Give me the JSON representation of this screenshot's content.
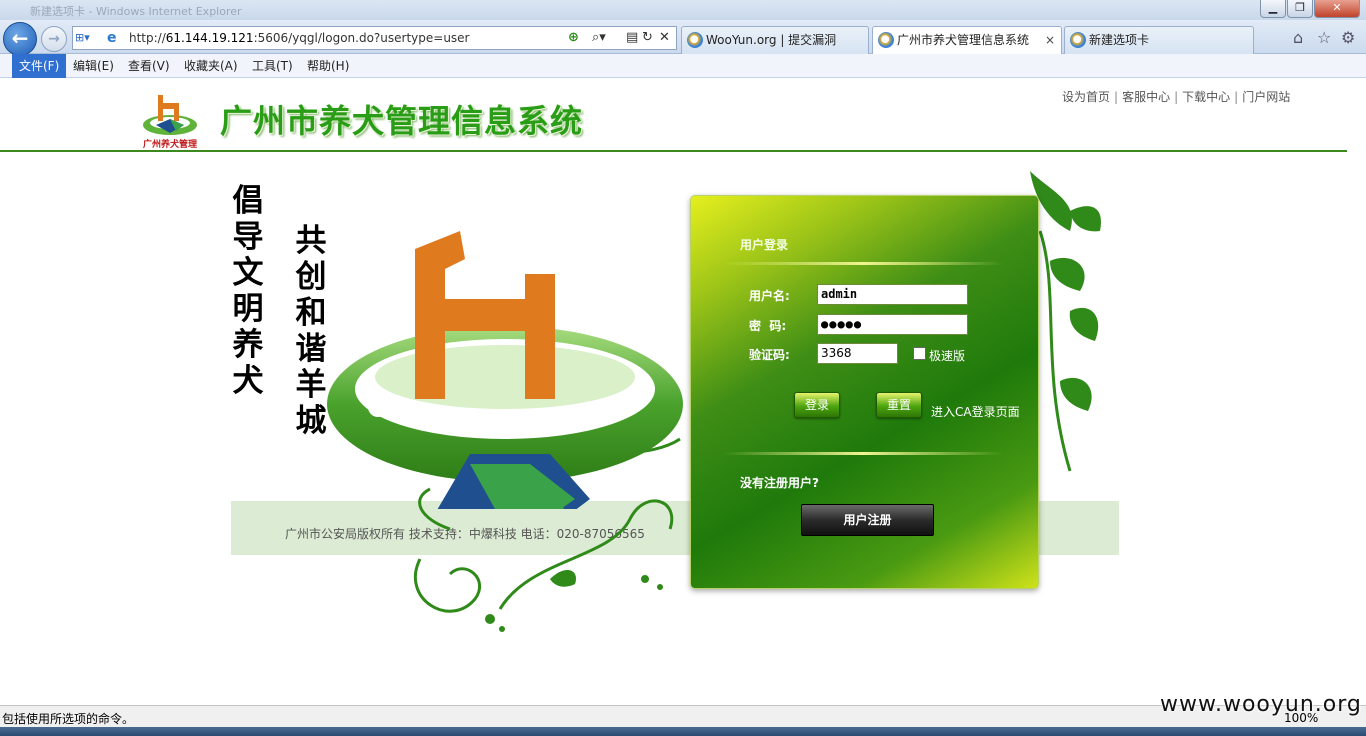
{
  "browser": {
    "window_title": "新建选项卡 - Windows Internet Explorer",
    "url_prefix": "http://",
    "url_host": "61.144.19.121",
    "url_rest": ":5606/yqgl/logon.do?usertype=user",
    "tabs": [
      {
        "label": "WooYun.org | 提交漏洞"
      },
      {
        "label": "广州市养犬管理信息系统",
        "close": "×"
      },
      {
        "label": "新建选项卡"
      }
    ],
    "menu": [
      "文件(F)",
      "编辑(E)",
      "查看(V)",
      "收藏夹(A)",
      "工具(T)",
      "帮助(H)"
    ],
    "status_text": "包括使用所选项的命令。",
    "zoom": "100%",
    "watermark": "www.wooyun.org"
  },
  "site": {
    "title": "广州市养犬管理信息系统",
    "logo_text": "广州养犬管理",
    "top_links": [
      "设为首页",
      "客服中心",
      "下载中心",
      "门户网站"
    ],
    "slogan_left": "倡导文明养犬",
    "slogan_right": "共创和谐羊城",
    "footer": "广州市公安局版权所有 技术支持：中爆科技 电话：020-87056565"
  },
  "login": {
    "title": "用户登录",
    "username_label": "用户名:",
    "username_value": "admin",
    "password_label": "密  码:",
    "password_value": "●●●●●",
    "captcha_label": "验证码:",
    "captcha_value": "3368",
    "fast_label": "极速版",
    "login_button": "登录",
    "reset_button": "重置",
    "ca_link": "进入CA登录页面",
    "no_register": "没有注册用户?",
    "register_button": "用户注册"
  },
  "colors": {
    "brand_green": "#2a9d16",
    "header_line": "#3c8a1e",
    "dog_orange": "#e07a1f",
    "hand_blue": "#1f4f8f"
  }
}
